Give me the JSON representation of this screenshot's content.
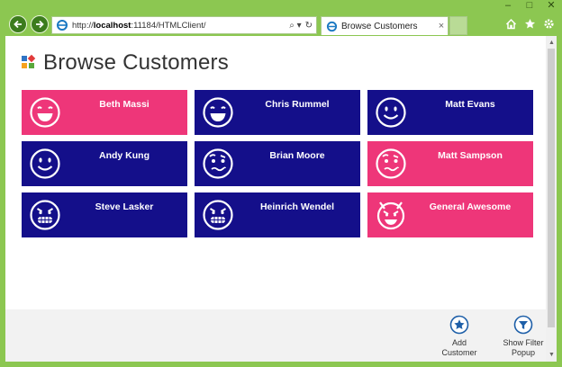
{
  "browser": {
    "url_prefix": "http://",
    "url_host": "localhost",
    "url_rest": ":11184/HTMLClient/",
    "tab_title": "Browse Customers",
    "tab_close": "×",
    "window_controls": [
      "–",
      "□",
      "✕"
    ],
    "addr_tools": [
      "⌕ ▾",
      "↻"
    ]
  },
  "page": {
    "title": "Browse Customers"
  },
  "colors": {
    "pink": "#ee3679",
    "navy": "#140f8a"
  },
  "customers": [
    {
      "name": "Beth Massi",
      "face": "laughing-face-icon",
      "color": "pink"
    },
    {
      "name": "Chris Rummel",
      "face": "laughing-face-icon",
      "color": "navy"
    },
    {
      "name": "Matt Evans",
      "face": "smiling-face-icon",
      "color": "navy"
    },
    {
      "name": "Andy Kung",
      "face": "smiling-face-icon",
      "color": "navy"
    },
    {
      "name": "Brian Moore",
      "face": "confused-face-icon",
      "color": "navy"
    },
    {
      "name": "Matt Sampson",
      "face": "confused-face-icon",
      "color": "pink"
    },
    {
      "name": "Steve Lasker",
      "face": "grinning-evil-face-icon",
      "color": "navy"
    },
    {
      "name": "Heinrich Wendel",
      "face": "grinning-evil-face-icon",
      "color": "navy"
    },
    {
      "name": "General Awesome",
      "face": "devil-face-icon",
      "color": "pink"
    }
  ],
  "commands": {
    "add": {
      "line1": "Add",
      "line2": "Customer",
      "icon": "star-icon"
    },
    "filter": {
      "line1": "Show Filter",
      "line2": "Popup",
      "icon": "filter-icon"
    }
  }
}
